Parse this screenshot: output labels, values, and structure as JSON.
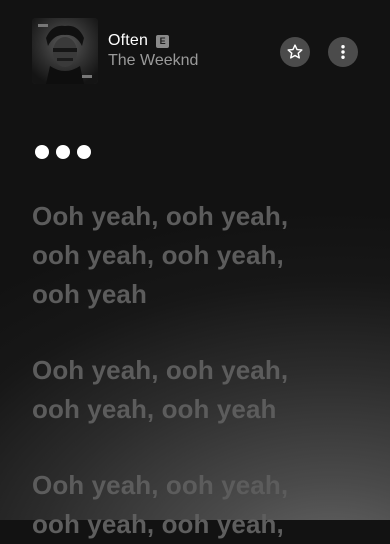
{
  "now_playing": {
    "title": "Often",
    "explicit_label": "E",
    "artist": "The Weeknd"
  },
  "icons": {
    "favorite": "star-outline-icon",
    "more": "vertical-ellipsis-icon",
    "instrumental": "ellipsis-dots-icon"
  },
  "lyrics": [
    {
      "lines": [
        "Ooh yeah, ooh yeah,",
        "ooh yeah, ooh yeah,",
        "ooh yeah"
      ]
    },
    {
      "lines": [
        "Ooh yeah, ooh yeah,",
        "ooh yeah, ooh yeah"
      ]
    },
    {
      "lines": [
        "Ooh yeah, ooh yeah,",
        "ooh yeah, ooh yeah,"
      ]
    }
  ],
  "colors": {
    "lyric_inactive": "#5c5c5c",
    "button_bg": "#4b4b4b",
    "explicit_badge": "#8a8a8a"
  }
}
